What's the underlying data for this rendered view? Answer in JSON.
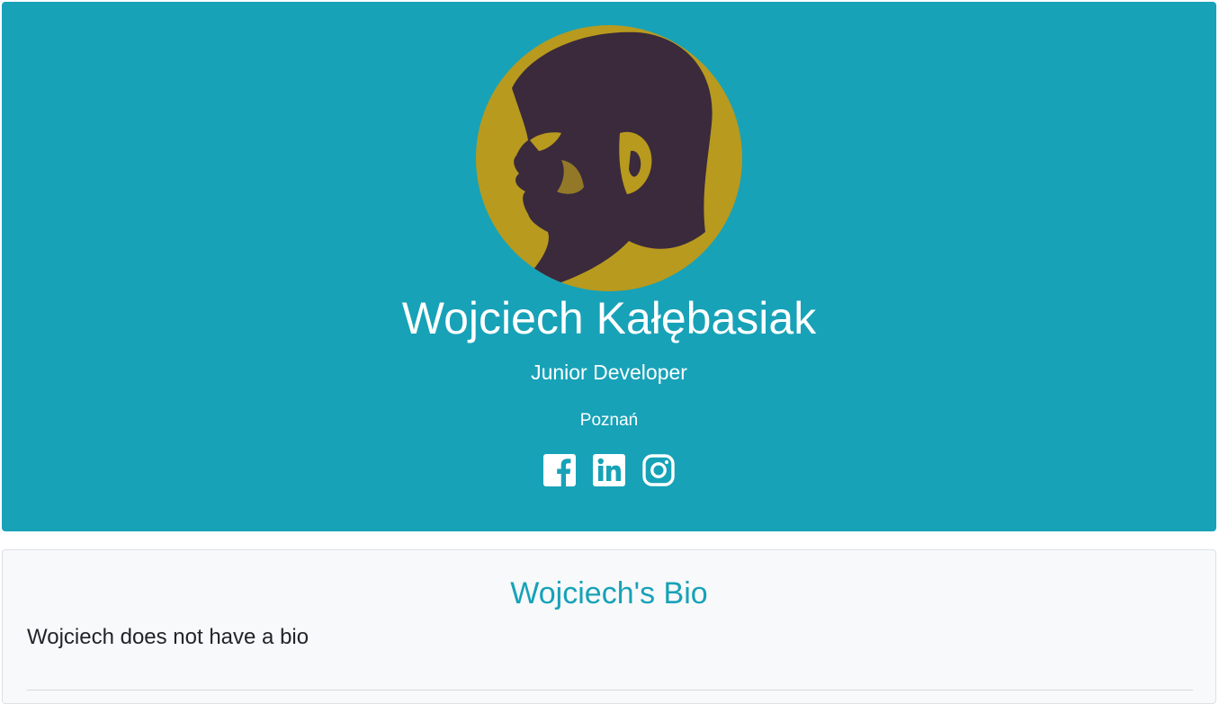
{
  "profile": {
    "name": "Wojciech Kałębasiak",
    "title": "Junior Developer",
    "location": "Poznań",
    "avatar": "profile-photo",
    "social": [
      {
        "network": "facebook",
        "icon": "facebook-icon"
      },
      {
        "network": "linkedin",
        "icon": "linkedin-icon"
      },
      {
        "network": "instagram",
        "icon": "instagram-icon"
      }
    ]
  },
  "bio": {
    "heading": "Wojciech's Bio",
    "text": "Wojciech does not have a bio"
  },
  "colors": {
    "header_bg": "#17a2b8",
    "heading_accent": "#17a2b8",
    "avatar_bg": "#b89a1e",
    "avatar_fg": "#3a2a3c",
    "card_bg": "#f8f9fa"
  }
}
